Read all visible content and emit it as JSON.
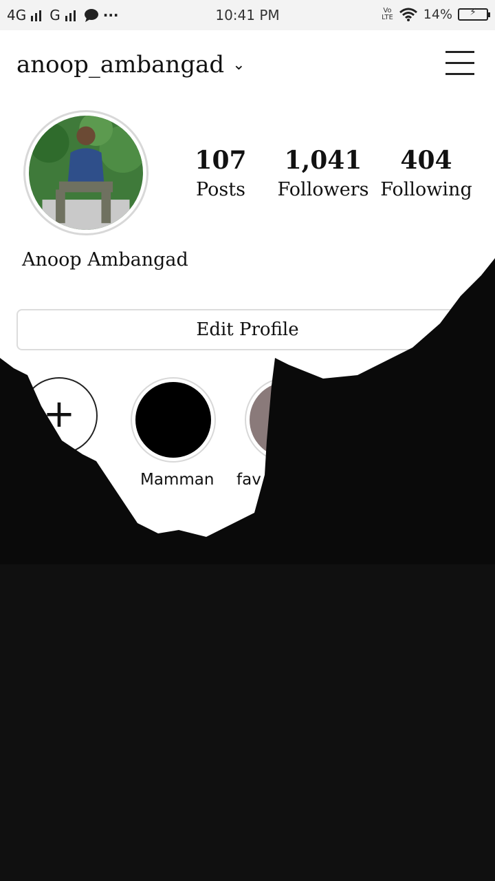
{
  "status_bar": {
    "signal1": "4G",
    "signal2": "G",
    "more": "···",
    "time": "10:41 PM",
    "lte_top": "Vo",
    "lte_bottom": "LTE",
    "battery_pct": "14%"
  },
  "header": {
    "username": "anoop_ambangad"
  },
  "profile": {
    "full_name": "Anoop Ambangad",
    "stats": [
      {
        "value": "107",
        "label": "Posts"
      },
      {
        "value": "1,041",
        "label": "Followers"
      },
      {
        "value": "404",
        "label": "Following"
      }
    ],
    "edit_label": "Edit Profile"
  },
  "highlights": [
    {
      "label": ""
    },
    {
      "label": "Mamman"
    },
    {
      "label": "fav"
    }
  ]
}
